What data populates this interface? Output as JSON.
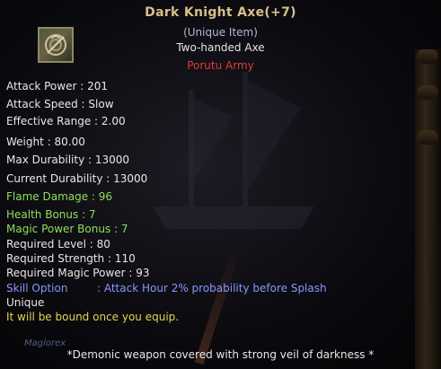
{
  "item": {
    "name": "Dark Knight Axe(+7)",
    "rarity": "(Unique Item)",
    "type": "Two-handed Axe",
    "faction": "Porutu Army",
    "icon": "axe-item-icon"
  },
  "stats": [
    {
      "key": "attack_power",
      "label": "Attack Power : 201"
    },
    {
      "key": "attack_speed",
      "label": "Attack Speed : Slow"
    },
    {
      "key": "effective_range",
      "label": "Effective Range : 2.00"
    },
    {
      "key": "weight",
      "label": "Weight : 80.00"
    },
    {
      "key": "max_durability",
      "label": "Max Durability : 13000"
    },
    {
      "key": "current_durability",
      "label": "Current Durability : 13000"
    },
    {
      "key": "flame_damage",
      "label": "Flame Damage : 96"
    },
    {
      "key": "health_bonus",
      "label": "Health Bonus : 7"
    },
    {
      "key": "magic_power_bonus",
      "label": "Magic Power Bonus : 7"
    },
    {
      "key": "required_level",
      "label": "Required Level : 80"
    },
    {
      "key": "required_strength",
      "label": "Required Strength : 110"
    },
    {
      "key": "required_magic_power",
      "label": "Required Magic Power : 93"
    }
  ],
  "skill_option": {
    "label": "Skill Option",
    "value": ": Attack Hour 2% probability before Splash"
  },
  "unique_label": "Unique",
  "bind_notice": "It will be bound once you equip.",
  "watermark": "Maglorex",
  "description": "*Demonic weapon covered with strong veil of darkness *",
  "colors": {
    "title": "#d8c089",
    "rarity": "#b6b6d6",
    "faction": "#e23a3a",
    "bonus_green": "#8ee05a",
    "skill_blue": "#8a96ff",
    "bind_yellow": "#e6d44e"
  }
}
